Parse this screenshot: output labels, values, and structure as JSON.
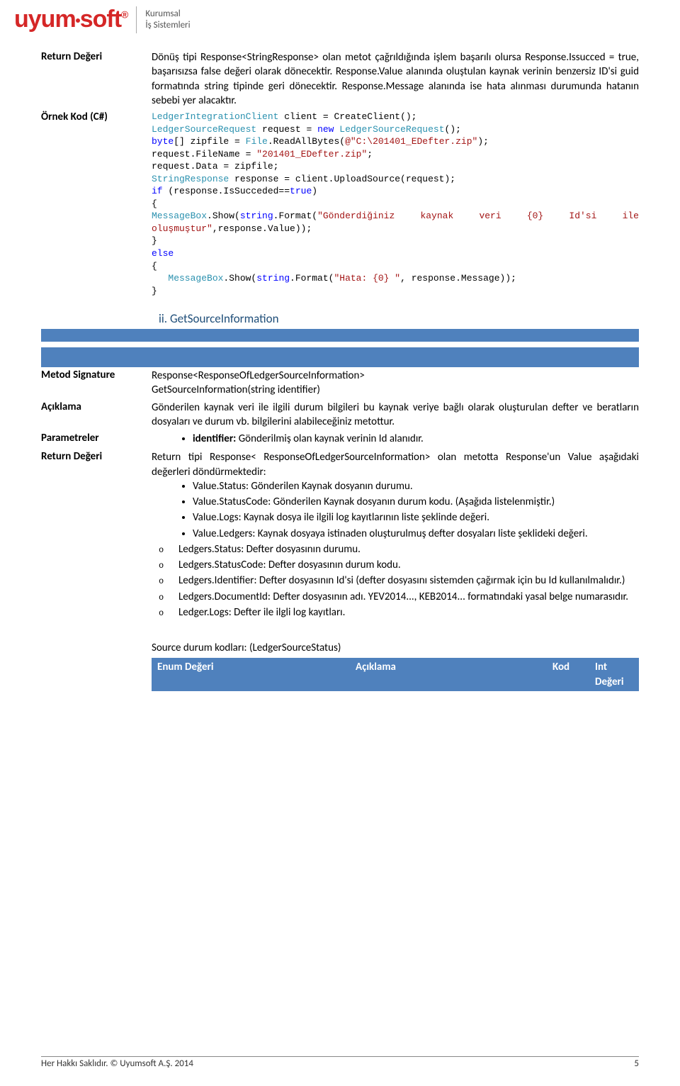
{
  "header": {
    "logo_text": "uyumsoft",
    "tagline_line1": "Kurumsal",
    "tagline_line2": "İş Sistemleri"
  },
  "table1": {
    "return_label": "Return Değeri",
    "return_value": "Dönüş tipi Response<StringResponse> olan metot çağrıldığında işlem başarılı olursa Response.Issucced = true, başarısızsa false değeri olarak dönecektir. Response.Value alanında oluştulan kaynak verinin benzersiz ID'si guid formatında string tipinde geri dönecektir. Response.Message alanında ise hata alınması durumunda hatanın sebebi yer alacaktır.",
    "code_label": "Örnek Kod (C#)",
    "code": {
      "l1a": "LedgerIntegrationClient",
      "l1b": " client = CreateClient();",
      "l2a": "LedgerSourceRequest",
      "l2b": " request = ",
      "l2c": "new",
      "l2d": " ",
      "l2e": "LedgerSourceRequest",
      "l2f": "();",
      "l3a": "byte",
      "l3b": "[] zipfile = ",
      "l3c": "File",
      "l3d": ".ReadAllBytes(",
      "l3e": "@\"C:\\201401_EDefter.zip\"",
      "l3f": ");",
      "l4a": "request.FileName = ",
      "l4b": "\"201401_EDefter.zip\"",
      "l4c": ";",
      "l5": "request.Data = zipfile;",
      "l6a": "StringResponse",
      "l6b": " response = client.UploadSource(request);",
      "l7a": "if",
      "l7b": " (response.IsSucceded==",
      "l7c": "true",
      "l7d": ")",
      "l8": "{",
      "l9a": "MessageBox",
      "l9b": ".Show(",
      "l9c": "string",
      "l9d": ".Format(",
      "l9e": "\"Gönderdiğiniz kaynak veri {0} Id'si ile oluşmuştur\"",
      "l9f": ",response.Value));",
      "l10": "}",
      "l11": "else",
      "l12": "{",
      "l13a": "   ",
      "l13b": "MessageBox",
      "l13c": ".Show(",
      "l13d": "string",
      "l13e": ".Format(",
      "l13f": "\"Hata: {0} \"",
      "l13g": ", response.Message));",
      "l14": "}"
    }
  },
  "subheading": "ii.    GetSourceInformation",
  "table2": {
    "sig_label": "Metod Signature",
    "sig_line1": "Response<ResponseOfLedgerSourceInformation>",
    "sig_line2": "GetSourceInformation(string identifier)",
    "desc_label": "Açıklama",
    "desc_value": "Gönderilen kaynak veri ile ilgili durum bilgileri bu kaynak veriye bağlı olarak oluşturulan defter ve beratların dosyaları ve durum vb. bilgilerini alabileceğiniz metottur.",
    "param_label": "Parametreler",
    "param_bullet": "identifier: Gönderilmiş olan kaynak verinin Id alanıdır.",
    "ret_label": "Return Değeri",
    "ret_intro": "Return tipi Response< ResponseOfLedgerSourceInformation> olan metotta Response'un Value aşağıdaki değerleri döndürmektedir:",
    "bullets": {
      "b1": "Value.Status: Gönderilen Kaynak dosyanın durumu.",
      "b2": "Value.StatusCode: Gönderilen Kaynak dosyanın durum kodu. (Aşağıda listelenmiştir.)",
      "b3": "Value.Logs: Kaynak dosya ile ilgili log kayıtlarının liste şeklinde değeri.",
      "b4": "Value.Ledgers: Kaynak dosyaya istinaden oluşturulmuş defter dosyaları liste şeklideki değeri."
    },
    "sub": {
      "s1": "Ledgers.Status: Defter dosyasının durumu.",
      "s2": "Ledgers.StatusCode: Defter dosyasının durum kodu.",
      "s3": "Ledgers.Identifier: Defter dosyasının Id'si (defter dosyasını sistemden çağırmak için bu Id kullanılmalıdır.)",
      "s4": "Ledgers.DocumentId: Defter dosyasının adı. YEV2014..., KEB2014... formatındaki yasal belge numarasıdır.",
      "s5": "Ledger.Logs: Defter ile ilgli log kayıtları."
    },
    "enum_caption": "Source durum kodları: (LedgerSourceStatus)",
    "enum_h1": "Enum Değeri",
    "enum_h2": "Açıklama",
    "enum_h3": "Kod",
    "enum_h4a": "Int",
    "enum_h4b": "Değeri"
  },
  "footer": {
    "left": "Her Hakkı Saklıdır. © Uyumsoft A.Ş. 2014",
    "right": "5"
  }
}
